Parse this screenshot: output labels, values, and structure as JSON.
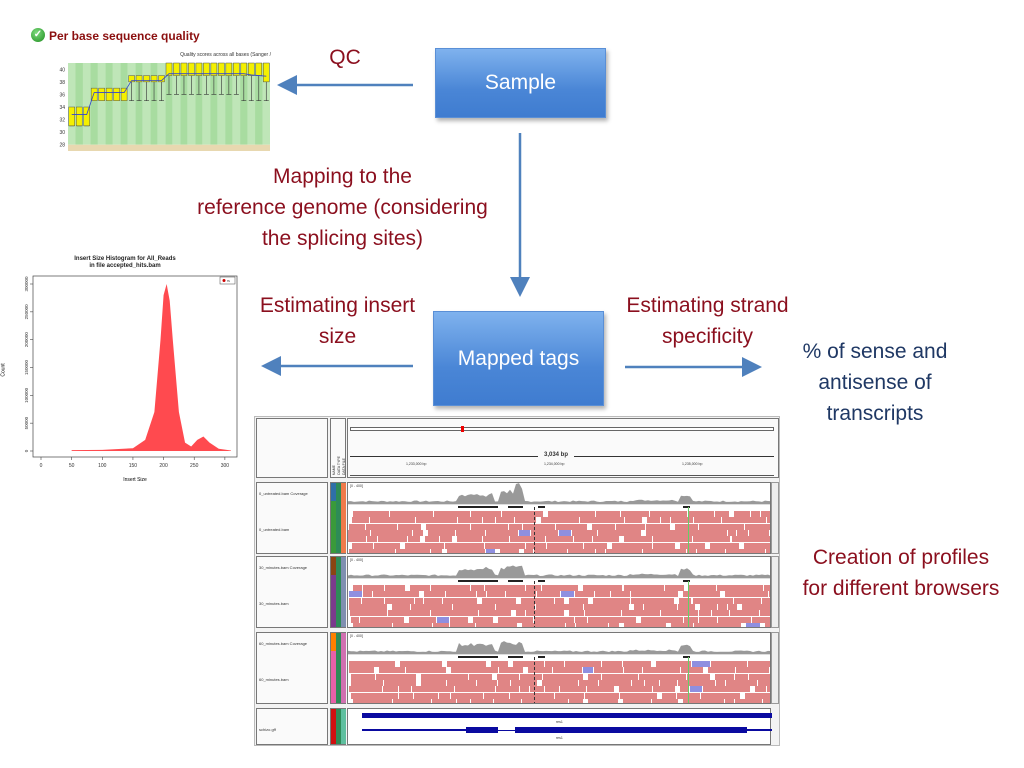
{
  "qc": {
    "title": "Per base sequence quality",
    "status_icon": "check-circle-icon",
    "chart_data": {
      "type": "box",
      "subtitle": "Quality scores across all bases (Sanger /",
      "yticks": [
        "28",
        "30",
        "32",
        "34",
        "36",
        "38",
        "40"
      ],
      "ylim": [
        27,
        41
      ],
      "grid": true,
      "means": [
        32.8,
        32.8,
        32.8,
        36.3,
        36.3,
        36.3,
        36.3,
        36.3,
        38.2,
        38.2,
        38.2,
        38.2,
        38.2,
        39.3,
        39.3,
        39.3,
        39.3,
        39.3,
        39.3,
        39.3,
        39.3,
        39.3,
        39.3,
        39.3,
        39.1,
        39.0,
        38.9
      ],
      "q1": [
        31,
        31,
        31,
        35,
        35,
        35,
        35,
        35,
        38,
        38,
        38,
        38,
        38,
        39,
        39,
        39,
        39,
        39,
        39,
        39,
        39,
        39,
        39,
        39,
        39,
        39,
        38
      ],
      "q3": [
        34,
        34,
        34,
        37,
        37,
        37,
        37,
        37,
        39,
        39,
        39,
        39,
        39,
        41,
        41,
        41,
        41,
        41,
        41,
        41,
        41,
        41,
        41,
        41,
        41,
        41,
        41
      ],
      "low": [
        31,
        31,
        31,
        35,
        35,
        35,
        35,
        35,
        35,
        35,
        35,
        35,
        35,
        36,
        36,
        36,
        36,
        36,
        36,
        36,
        36,
        36,
        36,
        35,
        35,
        35,
        35
      ]
    }
  },
  "histogram": {
    "chart_data": {
      "type": "area",
      "title": "Insert Size Histogram for All_Reads",
      "subtitle": "in file accepted_hits.bam",
      "xlabel": "Insert Size",
      "ylabel": "Count",
      "xticks": [
        "0",
        "50",
        "100",
        "150",
        "200",
        "250",
        "300"
      ],
      "yticks": [
        "0",
        "50000",
        "100000",
        "150000",
        "200000",
        "250000",
        "300000"
      ],
      "xlim": [
        0,
        310
      ],
      "ylim": [
        0,
        300000
      ],
      "legend": "top-right",
      "legend_entry": "rs",
      "color": "#ff4a4f",
      "x": [
        50,
        100,
        150,
        170,
        185,
        195,
        200,
        205,
        210,
        215,
        225,
        235,
        245,
        255,
        265,
        275,
        290,
        310
      ],
      "y": [
        1500,
        2000,
        5000,
        20000,
        70000,
        200000,
        280000,
        300000,
        270000,
        200000,
        70000,
        15000,
        8000,
        20000,
        26000,
        15000,
        4000,
        1000
      ]
    }
  },
  "flow": {
    "qc_label": "QC",
    "sample": "Sample",
    "mapping": [
      "Mapping to the",
      "reference genome (considering",
      "the splicing sites)"
    ],
    "insert": [
      "Estimating insert",
      "size"
    ],
    "mapped_tags": "Mapped tags",
    "strand": [
      "Estimating strand",
      "specificity"
    ],
    "sense": [
      "% of sense and",
      "antisense of",
      "transcripts"
    ],
    "profiles": [
      "Creation of profiles",
      "for different browsers"
    ]
  },
  "igv": {
    "ruler_span": "3,034 bp",
    "ruler_ticks": [
      "1,233,000 bp",
      "1,234,000 bp",
      "1,235,000 bp"
    ],
    "attr_headers": [
      "NAME",
      "DATA TYPE",
      "DATA FILE"
    ],
    "range": "[0 - 400]",
    "tracks": [
      {
        "coverage": "0_untreated.bam Coverage",
        "bam": "0_untreated.bam",
        "colors": [
          "#2f6fa8",
          "#3a9a3a",
          "#2e8b57",
          "#f07a4a"
        ]
      },
      {
        "coverage": "30_minutes.bam Coverage",
        "bam": "30_minutes.bam",
        "colors": [
          "#8b4513",
          "#7b3a8c",
          "#2e8b57",
          "#7f8fb0"
        ]
      },
      {
        "coverage": "60_minutes.bam Coverage",
        "bam": "60_minutes.bam",
        "colors": [
          "#ff7f00",
          "#e860a8",
          "#2e8b57",
          "#d070b0"
        ]
      }
    ],
    "gff": {
      "name": "schizo.gff",
      "gene": "res1",
      "colors": [
        "#d01010",
        "#2e8b57",
        "#5fbf9f"
      ]
    },
    "colors": {
      "read": "#e08585",
      "read_alt": "#8f8fe0",
      "coverage": "#999999",
      "gene": "#0a0aa0"
    }
  }
}
